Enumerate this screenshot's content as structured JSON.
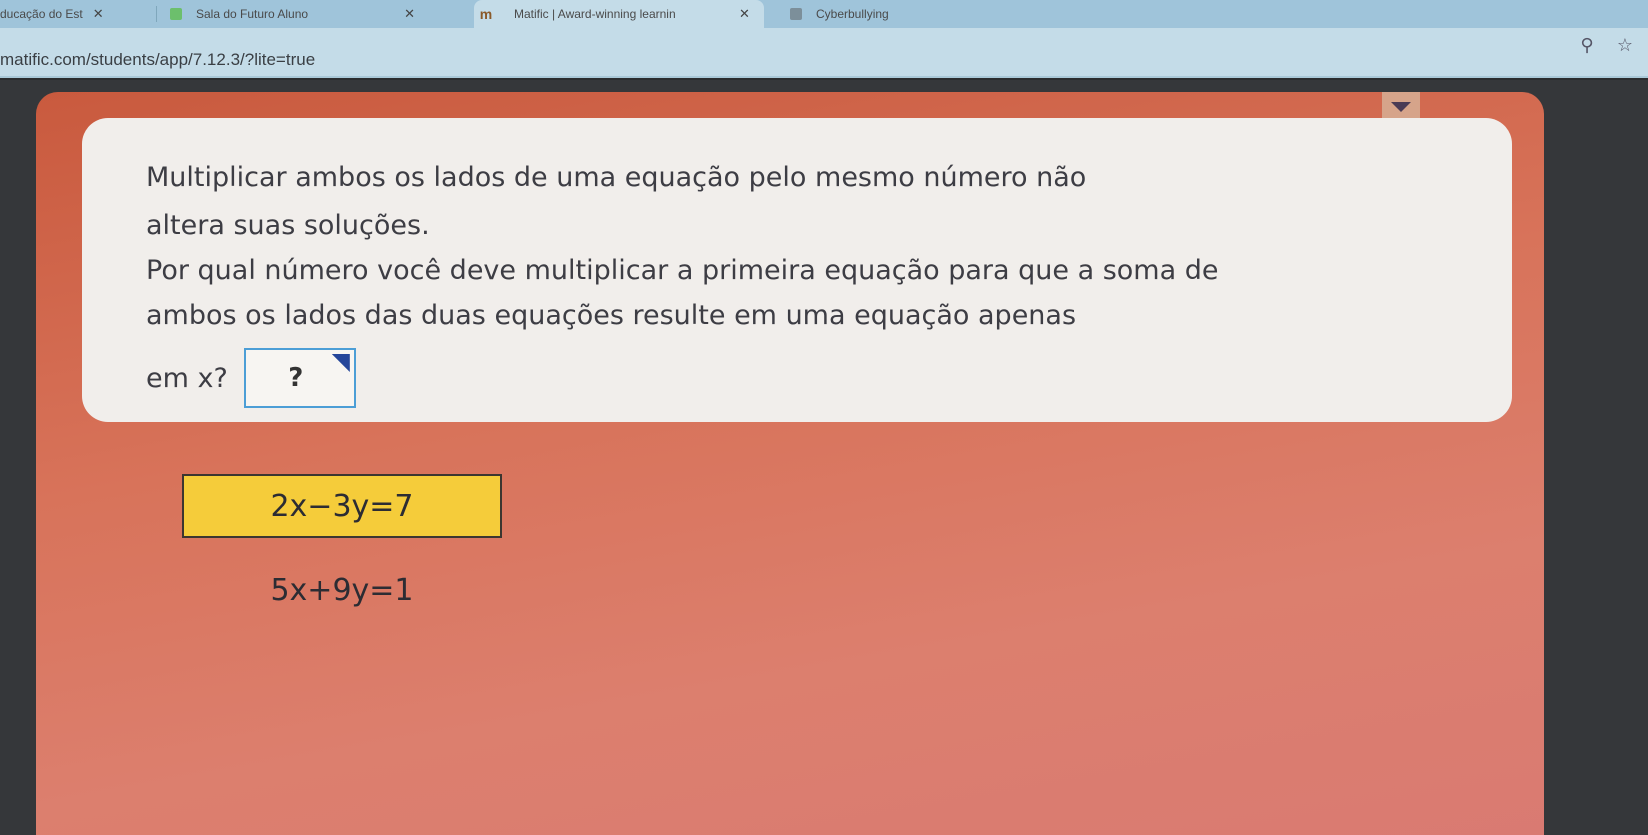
{
  "browser": {
    "tabs": [
      {
        "label": "ducação do Est",
        "close": "✕",
        "icon": "document-icon"
      },
      {
        "label": "Sala do Futuro Aluno",
        "close": "✕",
        "icon": "green-square-icon"
      },
      {
        "label": "Matific | Award-winning learnin",
        "close": "✕",
        "icon": "matific-m-icon",
        "favicon_text": "m"
      },
      {
        "label": "Cyberbullying",
        "icon": "grey-square-icon"
      }
    ],
    "url": "matific.com/students/app/7.12.3/?lite=true",
    "icons": {
      "search": "⚲",
      "star": "☆"
    }
  },
  "question": {
    "lines": [
      "Multiplicar ambos os lados de uma equação pelo mesmo número não",
      "altera suas soluções.",
      "Por qual número você deve multiplicar a primeira equação para que a soma de",
      "ambos os lados das duas equações resulte em uma equação apenas"
    ],
    "answer_prefix": "em x?",
    "answer_placeholder": "?"
  },
  "equations": [
    {
      "text": "2x−3y=7",
      "highlighted": true
    },
    {
      "text": "5x+9y=1",
      "highlighted": false
    }
  ],
  "colors": {
    "stage": "#d8735a",
    "card": "#f1eeeb",
    "highlight": "#f5cc3a",
    "answer_border": "#4c9ed6"
  }
}
